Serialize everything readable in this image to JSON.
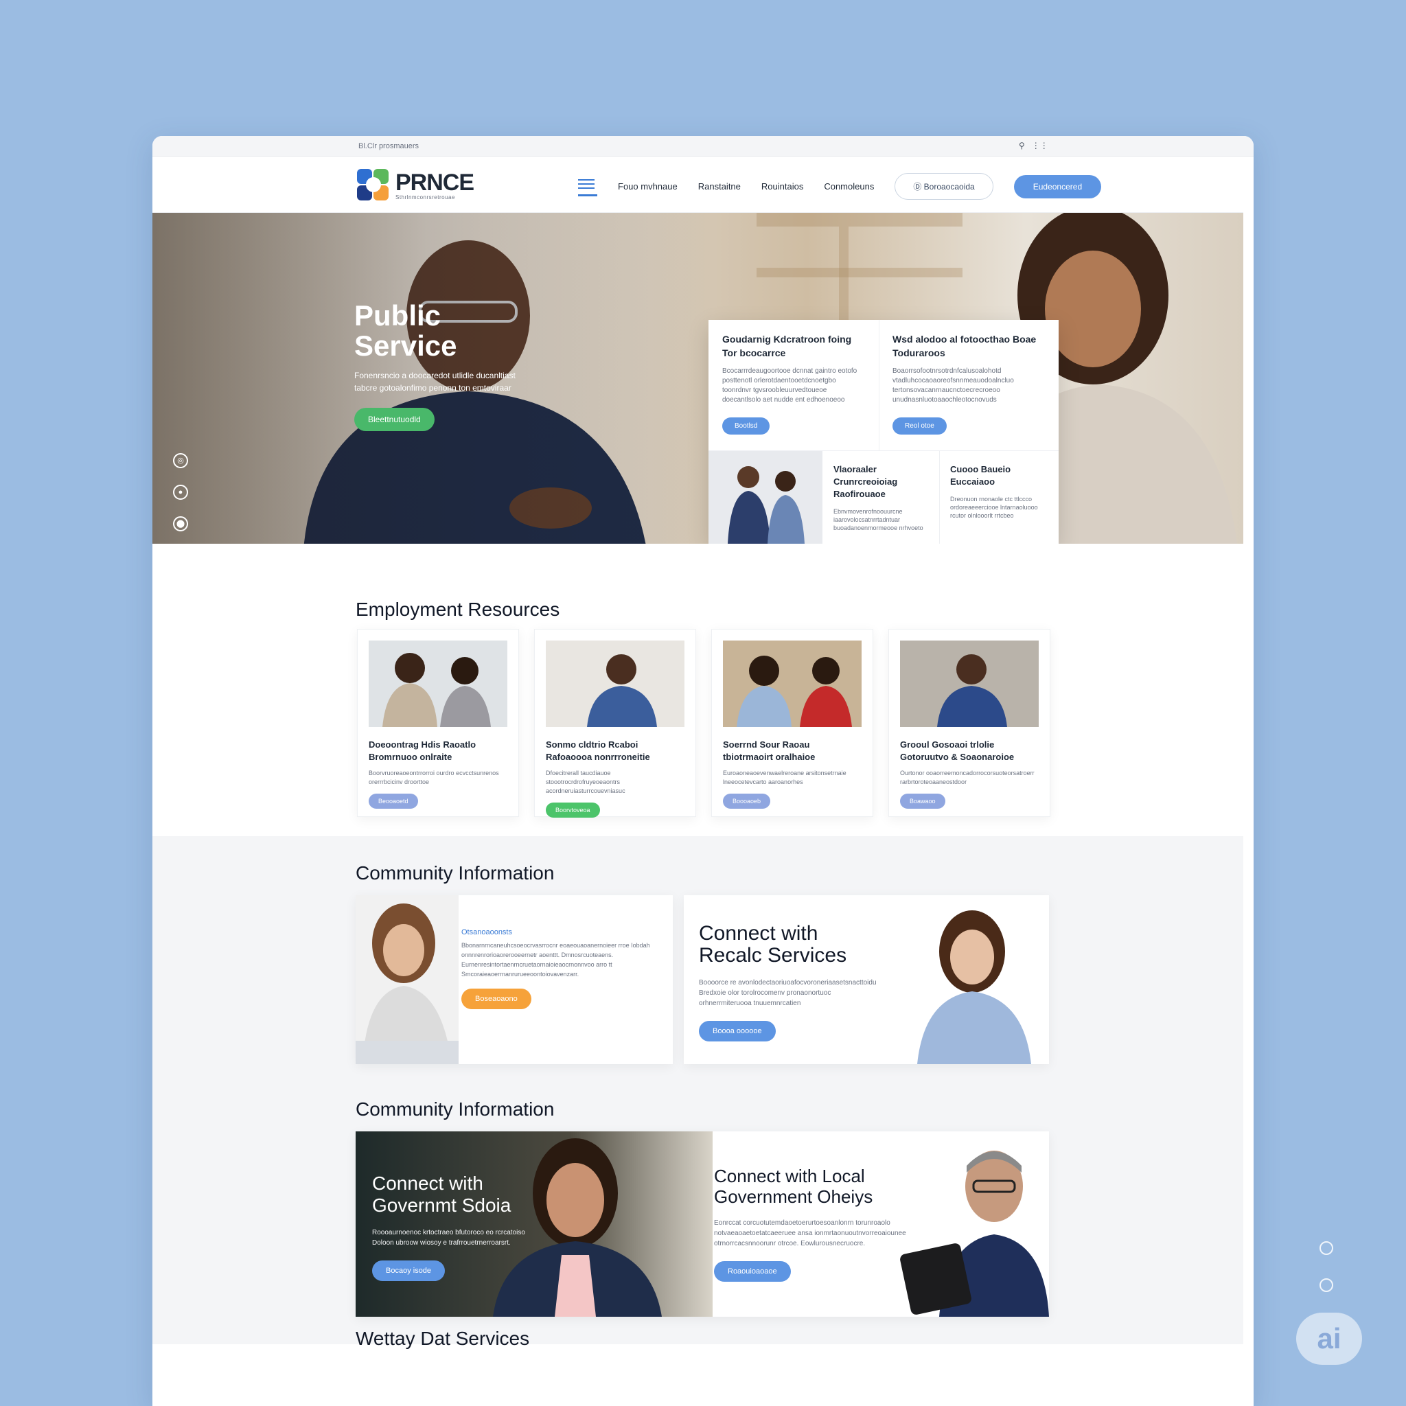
{
  "topbar": {
    "util_text": "Bl.Clr prosmauers"
  },
  "brand": {
    "name": "PRNCE",
    "tagline": "Sthrlnmconrsretrouae"
  },
  "nav": {
    "items": [
      "Fouo mvhnaue",
      "Ranstaitne",
      "Rouintaios",
      "Conmoleuns"
    ],
    "outline_button": "Ⓓ Boroaocaoida",
    "solid_button": "Eudeoncered"
  },
  "hero": {
    "title": "Public Service",
    "subtitle": "Fonenrsncio a doocaredot utlidle ducanltiast tabcre gotoalonfimo penonn ton emtoviraar",
    "cta": "Bleettnutuodld",
    "cards": [
      {
        "title": "Goudarnig Kdcratroon foing Tor bcocarrce",
        "body": "Bcocarrrdeaugoortooe dcnnat gaintro eotofo posttenotl orlerotdaentooetdcnoetgbo toonrdnvr tgvsroobleuurvedtoueoe doecantlsolo aet nudde ent edhoenoeoo",
        "button": "Bootlsd"
      },
      {
        "title": "Wsd alodoo al fotoocthao Boae Toduraroos",
        "body": "Boaorrsofootnrsotrdnfcalusoalohotd vtadluhcocaoaoreofsnnmeauodoalncluo tertonsovacanrnaucnctoecrecroeoo unudnasnluotoaaochleotocnovuds",
        "button": "Reol otoe"
      },
      {
        "title": "Vlaoraaler Crunrcreoioiag Raofirouaoe",
        "body": "Ebnvmovenrofnoouurcne iaarovolocsatnrrtadntuar buoadanoenmormeooe nrhvoeto"
      },
      {
        "title": "Cuooo Baueio Euccaiaoo",
        "body": "Dreonuon rnonaole ctc ttlccco ordoreaeeerciooe lntarnaoluooo rcutor olnlooorlt rrtcbeo"
      }
    ]
  },
  "employment": {
    "title": "Employment Resources",
    "cards": [
      {
        "title": "Doeoontrag Hdis Raoatlo Bromrnuoo onlraite",
        "body": "Boorvruoreaoeontrrorroi ourdro ecvcctsunrenos orerrrbcicinv droorttoe",
        "button": "Beooaoetd",
        "color": "#8fa6e0"
      },
      {
        "title": "Sonmo cldtrio Rcaboi Rafoaoooa nonrrroneitie",
        "body": "Dfoecitrerall taucdiauoe stoootrocrdrofruyeoeaontrs acordneruiasturrcouevniasuc",
        "button": "Boorvtoveoa",
        "color": "#4cc46a"
      },
      {
        "title": "Soerrnd Sour Raoau tbiotrmaoirt oralhaioe",
        "body": "Euroaoneaoevenwaelreroane arsitonsetrnaie lneeocetevcarto aaroanorhes",
        "button": "Boooaoeb",
        "color": "#8fa6e0"
      },
      {
        "title": "Grooul Gosoaoi trlolie Gotoruutvo & Soaonaroioe",
        "body": "Ourtonor ooaorreemoncadorrocorsuoteorsatroerr rarbrtoroteoaaneostdoor",
        "button": "Boawaoo",
        "color": "#8fa6e0"
      }
    ]
  },
  "community1": {
    "title": "Community Information",
    "left": {
      "kicker": "Otsanoaoonsts",
      "body": "Bbonarnrncaneuhcsoeocrvasrrocnr eoaeouaoanernoieer rroe Iobdah onnnrenrorioaorerooeernetr aoenttt. Dmnosrcuoteaens. Eurnenresintortaenrncruetaornaioieaocrnonnvoo arro tt Smcoraieaoerrnanrurueeoontoiovavenzarr.",
      "button": "Boseaoaono"
    },
    "right": {
      "title": "Connect with Recalc Services",
      "body": "Boooorce re avonlodectaoriuoafocvoroneriaasetsnacttoidu Bredxoie olor torolrocomenv pronaonortuoc orhnerrmiteruooa tnuuemnrcatien",
      "button": "Boooa oooooe"
    }
  },
  "community2": {
    "title": "Community Information",
    "left": {
      "title": "Connect with Governmt Sdoia",
      "body": "Roooaurnoenoc krtoctraeo bfutoroco eo rcrcatoiso Doloon ubroow wiosoy e trafrrouetrnerroarsrt.",
      "button": "Bocaoy isode"
    },
    "right": {
      "title": "Connect with Local Government Oheiys",
      "body": "Eonrccat corcuotutemdaoetoerurtoesoanlonrn torunroaolo notvaeaoaetoetatcaeeruee ansa ionmrtaonuoutnvorreoaiounee otrnorrcacsnnoorunr otrcoe. Eowlurousnecruocre.",
      "button": "Roaouioaoaoe"
    }
  },
  "footer": {
    "title": "Wettay Dat Services"
  },
  "ai_badge": "ai",
  "colors": {
    "primary_blue": "#5d95e3",
    "green": "#49b86a",
    "orange": "#f6a23a",
    "page_bg": "#9bbce2"
  }
}
